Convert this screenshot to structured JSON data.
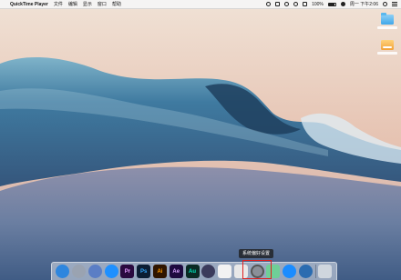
{
  "menubar": {
    "apple": "",
    "app_name": "QuickTime Player",
    "menus": [
      "文件",
      "编辑",
      "显示",
      "窗口",
      "帮助"
    ],
    "battery_percent": "100%",
    "clock": "周一 下午2:06",
    "user": "iCloud"
  },
  "desktop": {
    "icons": [
      "folder",
      "drive"
    ]
  },
  "tooltip": {
    "text": "系统偏好设置"
  },
  "dock": {
    "apps": [
      {
        "name": "Finder",
        "icon": "finder-icon",
        "color": "#2e86de"
      },
      {
        "name": "Launchpad",
        "icon": "launchpad-icon",
        "color": "#9aa3b1"
      },
      {
        "name": "Safari",
        "icon": "safari-icon",
        "color": "#1e90ff"
      },
      {
        "name": "Maps",
        "icon": "maps-icon",
        "color": "#4caf50"
      },
      {
        "name": "Premiere",
        "label": "Pr",
        "color": "#2a0a3f",
        "text": "#e39bff"
      },
      {
        "name": "Photoshop",
        "label": "Ps",
        "color": "#0b1d33",
        "text": "#31a8ff"
      },
      {
        "name": "Illustrator",
        "label": "Ai",
        "color": "#2f1500",
        "text": "#ff9a00"
      },
      {
        "name": "After Effects",
        "label": "Ae",
        "color": "#1e0a3f",
        "text": "#d9a4ff"
      },
      {
        "name": "Audition",
        "label": "Au",
        "color": "#0a2a24",
        "text": "#00e4bb"
      },
      {
        "name": "Migration",
        "icon": "app-icon",
        "color": "#3b3b5c"
      },
      {
        "name": "Notes",
        "icon": "notes-icon",
        "color": "#f2f2f2"
      },
      {
        "name": "Preview",
        "icon": "preview-icon",
        "color": "#e8e8e8"
      },
      {
        "name": "System Preferences",
        "icon": "gear-icon",
        "color": "#8a8f98"
      },
      {
        "name": "Stickies",
        "icon": "stickies-icon",
        "color": "#6fcf97"
      },
      {
        "name": "App Store",
        "icon": "appstore-icon",
        "color": "#1a8cff"
      },
      {
        "name": "QuickTime",
        "icon": "quicktime-icon",
        "color": "#2b6cb0"
      },
      {
        "name": "Trash",
        "icon": "trash-icon",
        "color": "#cfd6de"
      }
    ]
  },
  "colors": {
    "highlight": "#e02020"
  }
}
